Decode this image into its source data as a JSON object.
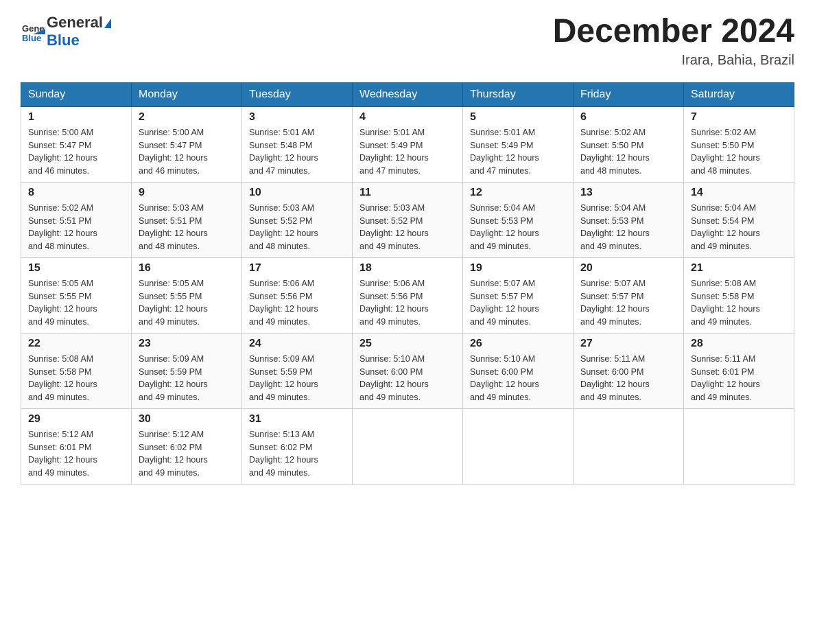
{
  "header": {
    "logo_text_general": "General",
    "logo_text_blue": "Blue",
    "title": "December 2024",
    "subtitle": "Irara, Bahia, Brazil"
  },
  "weekdays": [
    "Sunday",
    "Monday",
    "Tuesday",
    "Wednesday",
    "Thursday",
    "Friday",
    "Saturday"
  ],
  "weeks": [
    [
      {
        "day": "1",
        "sunrise": "5:00 AM",
        "sunset": "5:47 PM",
        "daylight": "12 hours and 46 minutes."
      },
      {
        "day": "2",
        "sunrise": "5:00 AM",
        "sunset": "5:47 PM",
        "daylight": "12 hours and 46 minutes."
      },
      {
        "day": "3",
        "sunrise": "5:01 AM",
        "sunset": "5:48 PM",
        "daylight": "12 hours and 47 minutes."
      },
      {
        "day": "4",
        "sunrise": "5:01 AM",
        "sunset": "5:49 PM",
        "daylight": "12 hours and 47 minutes."
      },
      {
        "day": "5",
        "sunrise": "5:01 AM",
        "sunset": "5:49 PM",
        "daylight": "12 hours and 47 minutes."
      },
      {
        "day": "6",
        "sunrise": "5:02 AM",
        "sunset": "5:50 PM",
        "daylight": "12 hours and 48 minutes."
      },
      {
        "day": "7",
        "sunrise": "5:02 AM",
        "sunset": "5:50 PM",
        "daylight": "12 hours and 48 minutes."
      }
    ],
    [
      {
        "day": "8",
        "sunrise": "5:02 AM",
        "sunset": "5:51 PM",
        "daylight": "12 hours and 48 minutes."
      },
      {
        "day": "9",
        "sunrise": "5:03 AM",
        "sunset": "5:51 PM",
        "daylight": "12 hours and 48 minutes."
      },
      {
        "day": "10",
        "sunrise": "5:03 AM",
        "sunset": "5:52 PM",
        "daylight": "12 hours and 48 minutes."
      },
      {
        "day": "11",
        "sunrise": "5:03 AM",
        "sunset": "5:52 PM",
        "daylight": "12 hours and 49 minutes."
      },
      {
        "day": "12",
        "sunrise": "5:04 AM",
        "sunset": "5:53 PM",
        "daylight": "12 hours and 49 minutes."
      },
      {
        "day": "13",
        "sunrise": "5:04 AM",
        "sunset": "5:53 PM",
        "daylight": "12 hours and 49 minutes."
      },
      {
        "day": "14",
        "sunrise": "5:04 AM",
        "sunset": "5:54 PM",
        "daylight": "12 hours and 49 minutes."
      }
    ],
    [
      {
        "day": "15",
        "sunrise": "5:05 AM",
        "sunset": "5:55 PM",
        "daylight": "12 hours and 49 minutes."
      },
      {
        "day": "16",
        "sunrise": "5:05 AM",
        "sunset": "5:55 PM",
        "daylight": "12 hours and 49 minutes."
      },
      {
        "day": "17",
        "sunrise": "5:06 AM",
        "sunset": "5:56 PM",
        "daylight": "12 hours and 49 minutes."
      },
      {
        "day": "18",
        "sunrise": "5:06 AM",
        "sunset": "5:56 PM",
        "daylight": "12 hours and 49 minutes."
      },
      {
        "day": "19",
        "sunrise": "5:07 AM",
        "sunset": "5:57 PM",
        "daylight": "12 hours and 49 minutes."
      },
      {
        "day": "20",
        "sunrise": "5:07 AM",
        "sunset": "5:57 PM",
        "daylight": "12 hours and 49 minutes."
      },
      {
        "day": "21",
        "sunrise": "5:08 AM",
        "sunset": "5:58 PM",
        "daylight": "12 hours and 49 minutes."
      }
    ],
    [
      {
        "day": "22",
        "sunrise": "5:08 AM",
        "sunset": "5:58 PM",
        "daylight": "12 hours and 49 minutes."
      },
      {
        "day": "23",
        "sunrise": "5:09 AM",
        "sunset": "5:59 PM",
        "daylight": "12 hours and 49 minutes."
      },
      {
        "day": "24",
        "sunrise": "5:09 AM",
        "sunset": "5:59 PM",
        "daylight": "12 hours and 49 minutes."
      },
      {
        "day": "25",
        "sunrise": "5:10 AM",
        "sunset": "6:00 PM",
        "daylight": "12 hours and 49 minutes."
      },
      {
        "day": "26",
        "sunrise": "5:10 AM",
        "sunset": "6:00 PM",
        "daylight": "12 hours and 49 minutes."
      },
      {
        "day": "27",
        "sunrise": "5:11 AM",
        "sunset": "6:00 PM",
        "daylight": "12 hours and 49 minutes."
      },
      {
        "day": "28",
        "sunrise": "5:11 AM",
        "sunset": "6:01 PM",
        "daylight": "12 hours and 49 minutes."
      }
    ],
    [
      {
        "day": "29",
        "sunrise": "5:12 AM",
        "sunset": "6:01 PM",
        "daylight": "12 hours and 49 minutes."
      },
      {
        "day": "30",
        "sunrise": "5:12 AM",
        "sunset": "6:02 PM",
        "daylight": "12 hours and 49 minutes."
      },
      {
        "day": "31",
        "sunrise": "5:13 AM",
        "sunset": "6:02 PM",
        "daylight": "12 hours and 49 minutes."
      },
      null,
      null,
      null,
      null
    ]
  ],
  "labels": {
    "sunrise": "Sunrise:",
    "sunset": "Sunset:",
    "daylight": "Daylight:"
  }
}
